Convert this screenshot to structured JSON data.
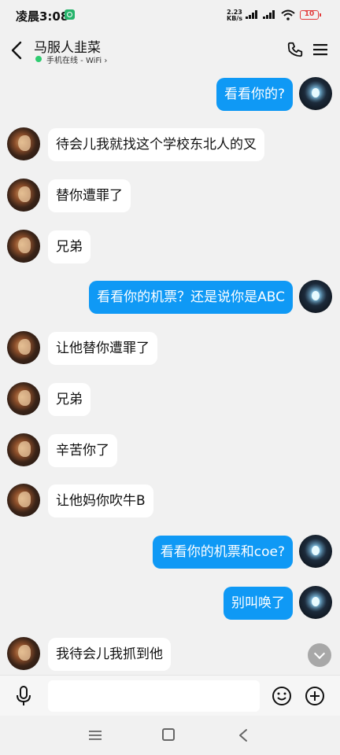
{
  "status_bar": {
    "time": "凌晨3:08",
    "net_speed_value": "2.23",
    "net_speed_unit": "KB/s",
    "battery": "10",
    "battery_color": "#e23b3b"
  },
  "header": {
    "title": "马服人韭菜",
    "online_status": "手机在线 - WiFi ›",
    "online_color": "#2fcc71"
  },
  "messages": [
    {
      "side": "right",
      "text": "看看你的?"
    },
    {
      "side": "left",
      "text": "待会儿我就找这个学校东北人的叉"
    },
    {
      "side": "left",
      "text": "替你遭罪了"
    },
    {
      "side": "left",
      "text": "兄弟"
    },
    {
      "side": "right",
      "text": "看看你的机票？还是说你是ABC"
    },
    {
      "side": "left",
      "text": "让他替你遭罪了"
    },
    {
      "side": "left",
      "text": "兄弟"
    },
    {
      "side": "left",
      "text": "辛苦你了"
    },
    {
      "side": "left",
      "text": "让他妈你吹牛B"
    },
    {
      "side": "right",
      "text": "看看你的机票和coe?"
    },
    {
      "side": "right",
      "text": "别叫唤了"
    },
    {
      "side": "left",
      "text": "我待会儿我抓到他"
    }
  ],
  "input": {
    "placeholder": ""
  },
  "colors": {
    "accent": "#0f99f5",
    "background": "#f1f1f1",
    "bubble_incoming": "#ffffff"
  },
  "icons": [
    "back-icon",
    "phone-icon",
    "menu-icon",
    "mic-icon",
    "emoji-icon",
    "plus-icon",
    "chevron-down-icon",
    "nav-menu-icon",
    "nav-home-icon",
    "nav-back-icon"
  ]
}
